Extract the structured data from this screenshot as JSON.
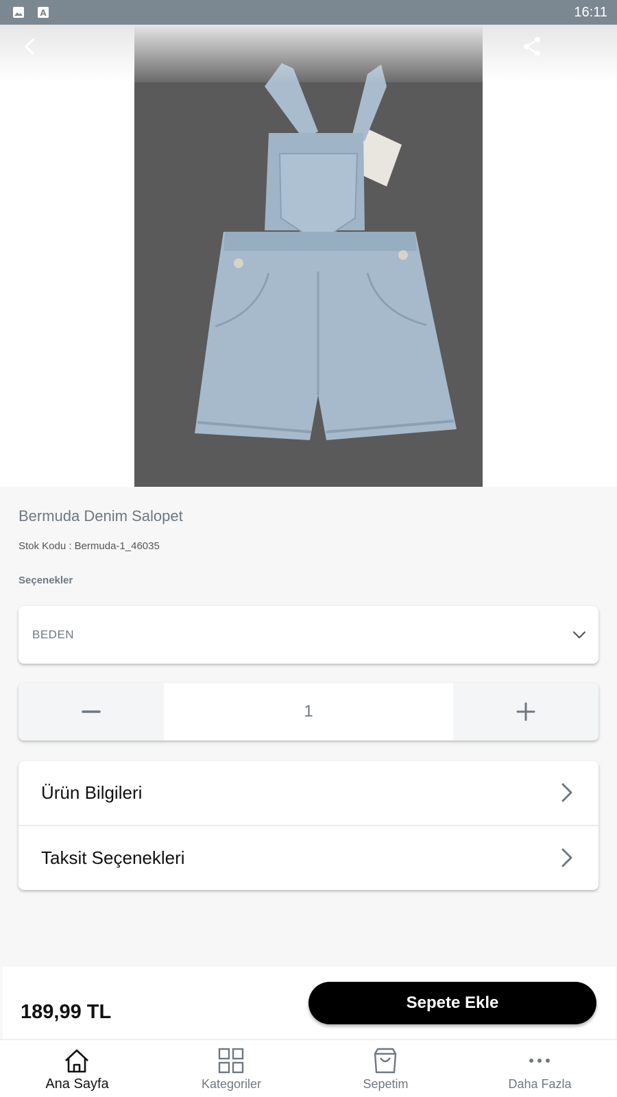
{
  "status_bar": {
    "time": "16:11"
  },
  "product": {
    "title": "Bermuda Denim Salopet",
    "sku_label": "Stok Kodu :",
    "sku_value": "Bermuda-1_46035",
    "image_description_icon": "denim-overalls-photo"
  },
  "options": {
    "label": "Seçenekler",
    "size_select": {
      "value": "BEDEN",
      "icon": "chevron-down-icon"
    }
  },
  "quantity": {
    "value": "1"
  },
  "info_rows": [
    {
      "label": "Ürün Bilgileri",
      "icon": "chevron-right-icon"
    },
    {
      "label": "Taksit Seçenekleri",
      "icon": "chevron-right-icon"
    }
  ],
  "buy_bar": {
    "price": "189,99 TL",
    "add_to_cart": "Sepete Ekle"
  },
  "tab_bar": [
    {
      "label": "Ana Sayfa",
      "icon": "home-icon",
      "active": true
    },
    {
      "label": "Kategoriler",
      "icon": "grid-icon",
      "active": false
    },
    {
      "label": "Sepetim",
      "icon": "shopping-bag-icon",
      "active": false
    },
    {
      "label": "Daha Fazla",
      "icon": "more-icon",
      "active": false
    }
  ],
  "colors": {
    "primary": "#000000",
    "muted_text": "#6f7780",
    "status_bar": "#7b8791",
    "background": "#f7f7f7"
  }
}
